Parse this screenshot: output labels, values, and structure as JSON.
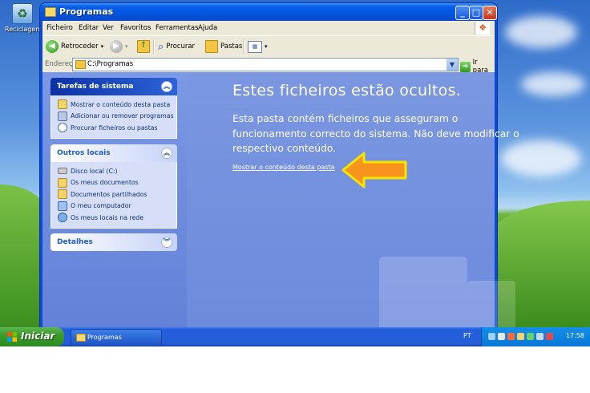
{
  "desktop": {
    "recycle_bin_label": "Reciclagem"
  },
  "window": {
    "title": "Programas",
    "menu": [
      "Ficheiro",
      "Editar",
      "Ver",
      "Favoritos",
      "Ferramentas",
      "Ajuda"
    ],
    "toolbar": {
      "back_label": "Retroceder",
      "search_label": "Procurar",
      "folders_label": "Pastas"
    },
    "address": {
      "label": "Endereço",
      "value": "C:\\Programas",
      "go_label": "Ir para"
    },
    "tasks_panel": {
      "title": "Tarefas de sistema",
      "items": [
        {
          "label": "Mostrar o conteúdo desta pasta",
          "icon": "show-contents-icon"
        },
        {
          "label": "Adicionar ou remover programas",
          "icon": "add-remove-programs-icon"
        },
        {
          "label": "Procurar ficheiros ou pastas",
          "icon": "search-icon"
        }
      ]
    },
    "other_places_panel": {
      "title": "Outros locais",
      "items": [
        {
          "label": "Disco local (C:)",
          "icon": "drive-icon"
        },
        {
          "label": "Os meus documentos",
          "icon": "documents-folder-icon"
        },
        {
          "label": "Documentos partilhados",
          "icon": "shared-folder-icon"
        },
        {
          "label": "O meu computador",
          "icon": "computer-icon"
        },
        {
          "label": "Os meus locais na rede",
          "icon": "network-icon"
        }
      ]
    },
    "details_panel": {
      "title": "Detalhes"
    },
    "main": {
      "title": "Estes ficheiros estão ocultos.",
      "description": "Esta pasta contém ficheiros que asseguram o funcionamento correcto do sistema. Não deve modificar o respectivo conteúdo.",
      "link": "Mostrar o conteúdo desta pasta"
    }
  },
  "taskbar": {
    "start_label": "Iniciar",
    "task_label": "Programas",
    "language": "PT",
    "clock": "17:58"
  },
  "colors": {
    "title_blue": "#0355e0",
    "content_blue": "#7b97e0",
    "arrow_orange": "#f7941d",
    "arrow_outline": "#f5e600"
  }
}
